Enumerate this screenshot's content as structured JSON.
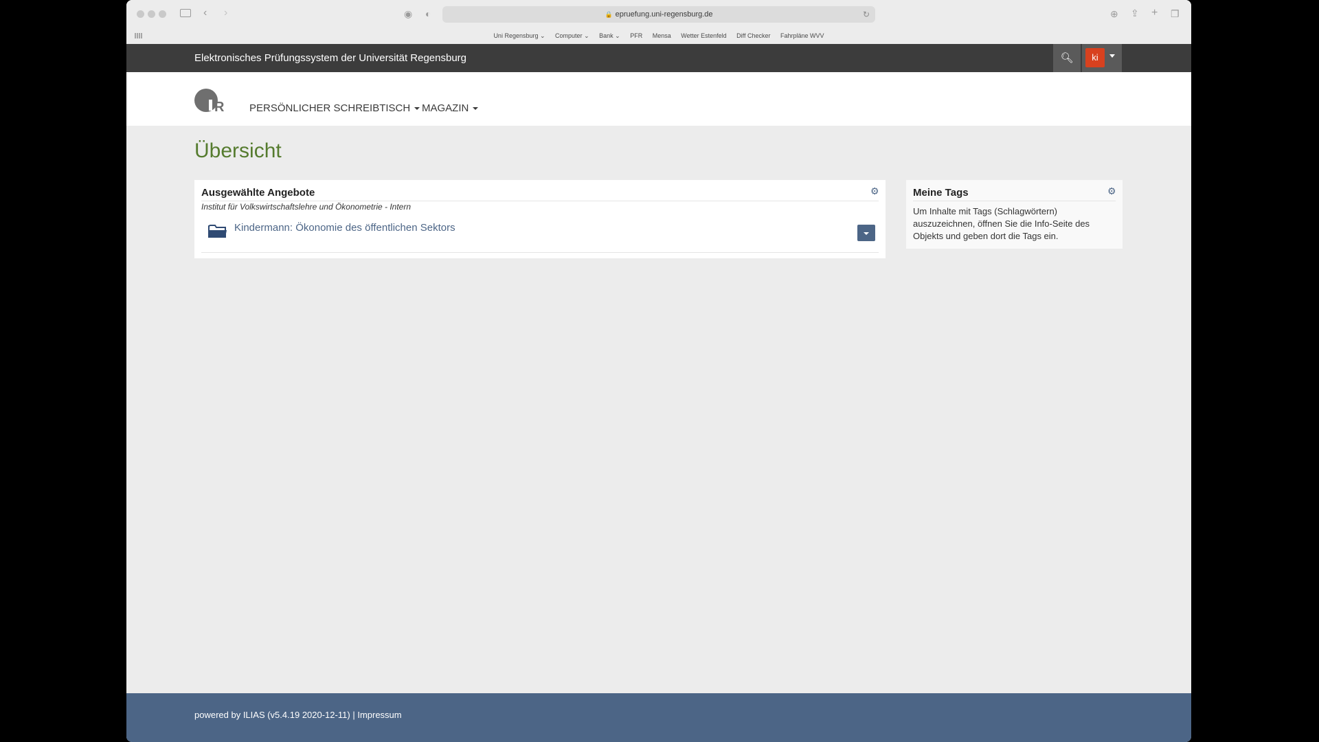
{
  "browser": {
    "url": "epruefung.uni-regensburg.de",
    "bookmarks": [
      "Uni Regensburg ⌄",
      "Computer ⌄",
      "Bank ⌄",
      "PFR",
      "Mensa",
      "Wetter Estenfeld",
      "Diff Checker",
      "Fahrpläne WVV"
    ]
  },
  "topbar": {
    "title": "Elektronisches Prüfungssystem der Universität Regensburg",
    "avatar_initials": "ki"
  },
  "logo": {
    "text": "UR"
  },
  "nav": {
    "items": [
      {
        "label": "PERSÖNLICHER SCHREIBTISCH"
      },
      {
        "label": "MAGAZIN"
      }
    ]
  },
  "page": {
    "title": "Übersicht"
  },
  "selected_offers": {
    "heading": "Ausgewählte Angebote",
    "subtitle": "Institut für Volkswirtschaftslehre und Ökonometrie - Intern",
    "items": [
      {
        "title": "Kindermann: Ökonomie des öffentlichen Sektors",
        "icon": "folder-icon"
      }
    ]
  },
  "my_tags": {
    "heading": "Meine Tags",
    "text": "Um Inhalte mit Tags (Schlagwörtern) auszuzeichnen, öffnen Sie die Info-Seite des Objekts und geben dort die Tags ein."
  },
  "footer": {
    "powered_by": "powered by ILIAS (v5.4.19 2020-12-11)",
    "separator": "|",
    "impressum": "Impressum"
  },
  "colors": {
    "accent": "#4c6586",
    "title_green": "#557b2e",
    "topbar": "#3c3c3c",
    "avatar": "#d8411f"
  }
}
